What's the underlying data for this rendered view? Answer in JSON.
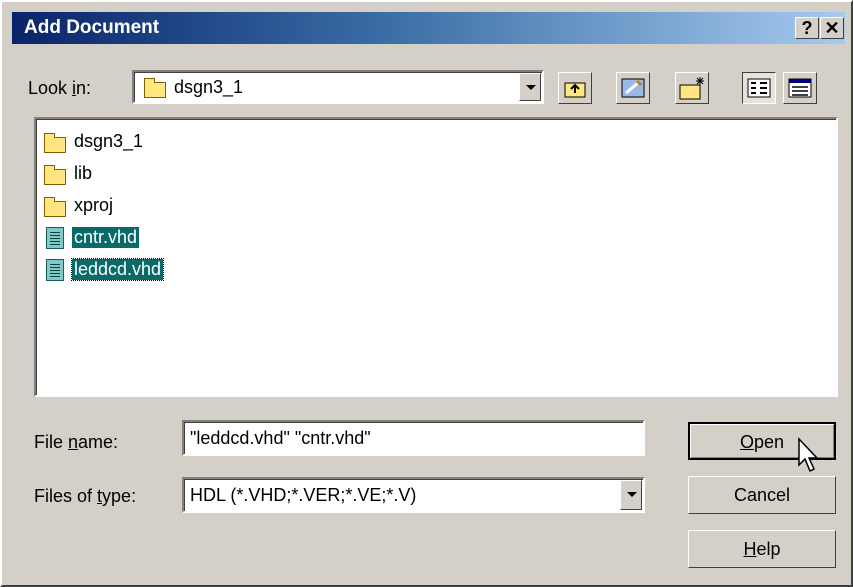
{
  "window": {
    "title": "Add Document",
    "help_glyph": "?",
    "close_glyph": "✕"
  },
  "lookin": {
    "label_pre": "Look ",
    "label_u": "i",
    "label_post": "n:",
    "value": "dsgn3_1"
  },
  "files": [
    {
      "name": "dsgn3_1",
      "type": "folder",
      "selected": false
    },
    {
      "name": "lib",
      "type": "folder",
      "selected": false
    },
    {
      "name": "xproj",
      "type": "folder",
      "selected": false
    },
    {
      "name": "cntr.vhd",
      "type": "file",
      "selected": true
    },
    {
      "name": "leddcd.vhd",
      "type": "file",
      "selected": true
    }
  ],
  "filename": {
    "label_pre": "File ",
    "label_u": "n",
    "label_post": "ame:",
    "value": "\"leddcd.vhd\" \"cntr.vhd\""
  },
  "filetype": {
    "label_pre": "Files of ",
    "label_u": "t",
    "label_post": "ype:",
    "value": "HDL (*.VHD;*.VER;*.VE;*.V)"
  },
  "buttons": {
    "open_u": "O",
    "open_rest": "pen",
    "cancel": "Cancel",
    "help_u": "H",
    "help_rest": "elp"
  }
}
